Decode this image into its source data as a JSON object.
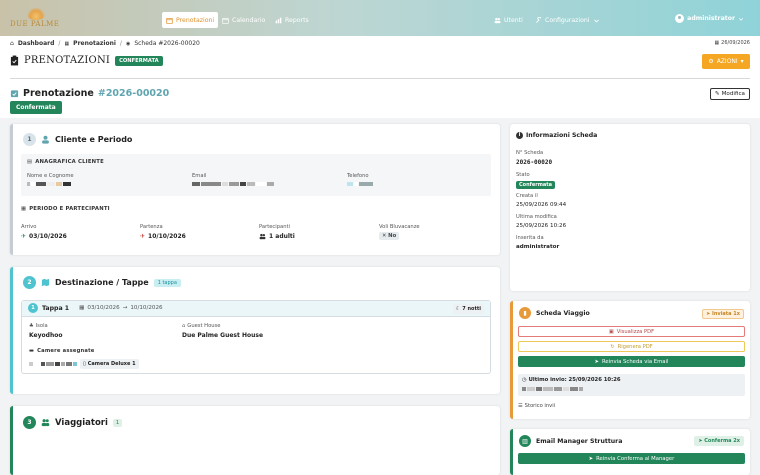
{
  "nav": {
    "logo_text": "DUE PALME",
    "items": [
      {
        "label": "Prenotazioni",
        "active": true
      },
      {
        "label": "Calendario",
        "active": false
      },
      {
        "label": "Reports",
        "active": false
      }
    ],
    "right_items": [
      {
        "label": "Utenti"
      },
      {
        "label": "Configurazioni"
      }
    ],
    "user": "administrator"
  },
  "breadcrumb": {
    "dashboard": "Dashboard",
    "prenotazioni": "Prenotazioni",
    "current": "Scheda #2026-00020"
  },
  "top_date": "26/09/2026",
  "page": {
    "title": "PRENOTAZIONI",
    "status_badge": "CONFERMATA",
    "actions_label": "AZIONI"
  },
  "booking": {
    "label": "Prenotazione",
    "code": "#2026-00020",
    "status": "Confermata",
    "edit_label": "Modifica"
  },
  "client_section": {
    "step": "1",
    "title": "Cliente e Periodo",
    "anagrafica_title": "ANAGRAFICA CLIENTE",
    "fields": {
      "name_label": "Nome e Cognome",
      "email_label": "Email",
      "phone_label": "Telefono"
    },
    "period_title": "PERIODO E PARTECIPANTI",
    "period": {
      "arrival_label": "Arrivo",
      "arrival": "03/10/2026",
      "departure_label": "Partenza",
      "departure": "10/10/2026",
      "participants_label": "Partecipanti",
      "participants": "1 adulti",
      "flights_label": "Voli Bluvacanze",
      "flights": "No"
    }
  },
  "destination_section": {
    "step": "2",
    "title": "Destinazione / Tappe",
    "count_badge": "1 tappa",
    "tappa": {
      "label": "Tappa 1",
      "from": "03/10/2026",
      "to": "10/10/2026",
      "nights": "7 notti",
      "island_label": "Isola",
      "island": "Keyodhoo",
      "guesthouse_label": "Guest House",
      "guesthouse": "Due Palme Guest House",
      "rooms_label": "Camere assegnate",
      "room": "Camera Deluxe 1"
    }
  },
  "travelers_section": {
    "step": "3",
    "title": "Viaggiatori",
    "count": "1"
  },
  "info_card": {
    "title": "Informazioni Scheda",
    "number_label": "N° Scheda",
    "number": "2026-00020",
    "status_label": "Stato",
    "status": "Confermata",
    "created_label": "Creata il",
    "created": "25/09/2026 09:44",
    "modified_label": "Ultima modifica",
    "modified": "25/09/2026 10:26",
    "inserted_label": "Inserita da",
    "inserted": "administrator"
  },
  "travel_card": {
    "title": "Scheda Viaggio",
    "sent_tag": "Inviata 1x",
    "view_pdf": "Visualizza PDF",
    "regen_pdf": "Rigenera PDF",
    "resend_email": "Reinvia Scheda via Email",
    "last_sent": "Ultimo invio: 25/09/2026 10:26",
    "history": "Storico invii"
  },
  "email_card": {
    "title": "Email Manager Struttura",
    "confirm_tag": "Conferma 2x",
    "resend": "Reinvia Conferma al Manager"
  },
  "colors": {
    "accent_orange": "#f5a623",
    "green": "#23865a",
    "teal": "#4fc3cf"
  }
}
